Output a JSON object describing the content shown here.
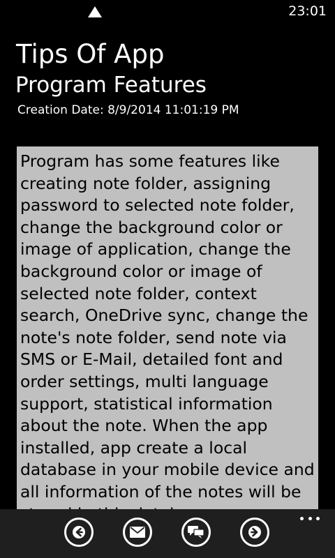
{
  "status_bar": {
    "time": "23:01",
    "signal_icon": "signal-triangle-icon"
  },
  "header": {
    "app_title": "Tips Of App",
    "page_title": "Program Features",
    "creation_date": "Creation Date: 8/9/2014 11:01:19 PM"
  },
  "note": {
    "background_color": "#c0c0c0",
    "text_color": "#000000",
    "body": "Program has some features like creating note folder, assigning password to selected note folder, change the background color or image of application, change the background color or image of selected note folder, context search, OneDrive sync, change the note's note folder, send note via SMS or E-Mail, detailed font and order settings, multi language support, statistical information about the note. When the app installed, app create a local database in your mobile device and all information of the notes will be stored in this database."
  },
  "app_bar": {
    "background_color": "#1f1f1f",
    "buttons": [
      {
        "icon": "arrow-left-icon"
      },
      {
        "icon": "mail-icon"
      },
      {
        "icon": "message-icon"
      },
      {
        "icon": "arrow-right-icon"
      }
    ],
    "more_icon": "ellipsis-icon"
  }
}
